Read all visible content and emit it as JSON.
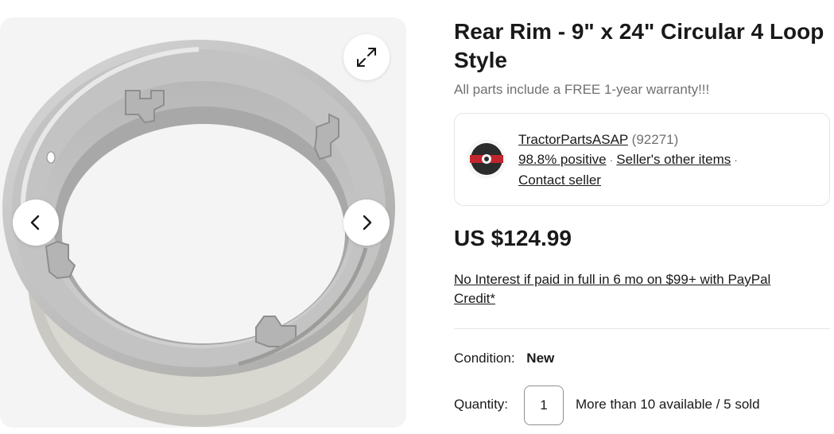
{
  "gallery": {
    "expand_icon": "expand-arrows-icon",
    "prev_icon": "chevron-left-icon",
    "next_icon": "chevron-right-icon"
  },
  "listing": {
    "title": "Rear Rim - 9\" x 24\" Circular 4 Loop Style",
    "subtitle": "All parts include a FREE 1-year warranty!!!",
    "price": "US $124.99",
    "financing": "No Interest if paid in full in 6 mo on $99+ with PayPal Credit*",
    "condition_label": "Condition:",
    "condition_value": "New",
    "quantity_label": "Quantity:",
    "quantity_value": "1",
    "availability": "More than 10 available / 5 sold"
  },
  "seller": {
    "name": "TractorPartsASAP",
    "feedback_count": "(92271)",
    "positive": "98.8% positive",
    "other_items": "Seller's other items",
    "contact": "Contact seller",
    "separator": "·"
  },
  "colors": {
    "text": "#191919",
    "muted": "#707070",
    "border": "#e5e5e5",
    "gallery_bg": "#f4f4f4"
  }
}
